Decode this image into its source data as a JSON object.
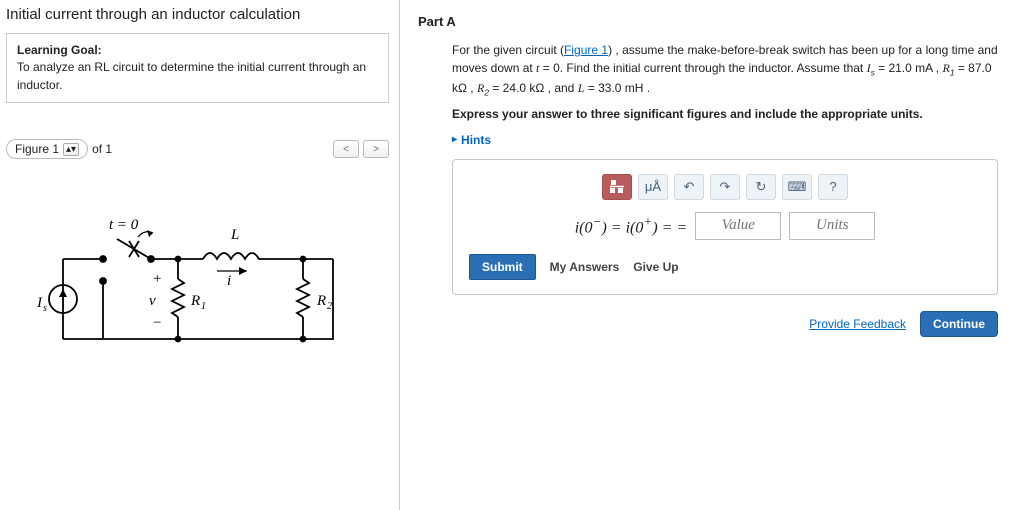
{
  "title": "Initial current through an inductor calculation",
  "goal": {
    "heading": "Learning Goal:",
    "text": "To analyze an RL circuit to determine the initial current through an inductor."
  },
  "figure": {
    "label": "Figure 1",
    "of_text": "of 1"
  },
  "part": {
    "label": "Part A",
    "question_prefix": "For the given circuit (",
    "figure_link": "Figure 1",
    "question_after_link": ") , assume the make-before-break switch has been up for a long time and moves down at ",
    "question_mid1": " = 0.  Find the initial current through the inductor. Assume that ",
    "Is": "Iₛ",
    "Is_val": " = 21.0 mA , ",
    "R1": "R₁",
    "R1_val": " = 87.0 kΩ , ",
    "R2": "R₂",
    "R2_val": " = 24.0 kΩ , and ",
    "L": "L",
    "L_val": " = 33.0 mH .",
    "instruction": "Express your answer to three significant figures and include the appropriate units.",
    "hints": "Hints"
  },
  "answer": {
    "equation": "i(0⁻) = i(0⁺) = =",
    "value_placeholder": "Value",
    "units_placeholder": "Units",
    "submit": "Submit",
    "my_answers": "My Answers",
    "give_up": "Give Up"
  },
  "footer": {
    "feedback": "Provide Feedback",
    "continue": "Continue"
  },
  "tooltips": {
    "frac": "x/y",
    "mu": "μÅ",
    "undo": "↶",
    "redo": "↷",
    "reset": "↻",
    "keyboard": "⌨",
    "help": "?"
  }
}
